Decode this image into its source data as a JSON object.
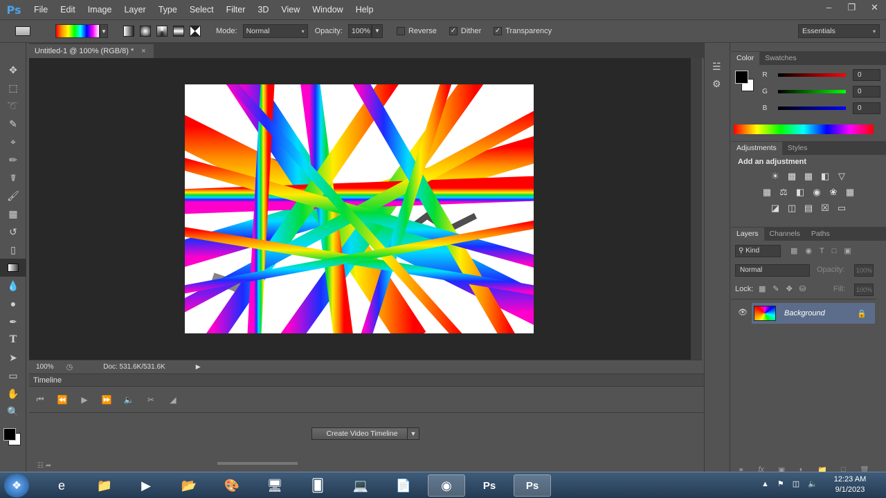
{
  "app": {
    "logo": "Ps"
  },
  "menu": [
    "File",
    "Edit",
    "Image",
    "Layer",
    "Type",
    "Select",
    "Filter",
    "3D",
    "View",
    "Window",
    "Help"
  ],
  "window_controls": [
    "minimize-icon",
    "restore-icon",
    "close-icon"
  ],
  "options": {
    "mode_label": "Mode:",
    "mode_value": "Normal",
    "opacity_label": "Opacity:",
    "opacity_value": "100%",
    "reverse_label": "Reverse",
    "dither_label": "Dither",
    "transparency_label": "Transparency",
    "reverse_checked": false,
    "dither_checked": true,
    "transparency_checked": true,
    "workspace": "Essentials"
  },
  "document": {
    "tab_title": "Untitled-1 @ 100% (RGB/8) *",
    "zoom": "100%",
    "doc_size": "Doc: 531.6K/531.6K"
  },
  "timeline": {
    "title": "Timeline",
    "create_button": "Create Video Timeline"
  },
  "color_panel": {
    "tabs": [
      "Color",
      "Swatches"
    ],
    "r_label": "R",
    "g_label": "G",
    "b_label": "B",
    "r_value": "0",
    "g_value": "0",
    "b_value": "0"
  },
  "adjustments_panel": {
    "tabs": [
      "Adjustments",
      "Styles"
    ],
    "heading": "Add an adjustment"
  },
  "layers_panel": {
    "tabs": [
      "Layers",
      "Channels",
      "Paths"
    ],
    "filter_kind": "Kind",
    "blend_mode": "Normal",
    "opacity_label": "Opacity:",
    "opacity_value": "100%",
    "lock_label": "Lock:",
    "fill_label": "Fill:",
    "fill_value": "100%",
    "layers": [
      {
        "name": "Background",
        "visible": true,
        "locked": true
      }
    ]
  },
  "taskbar": {
    "time": "12:23 AM",
    "date": "9/1/2023"
  },
  "colors": {
    "ui_bg": "#535353",
    "canvas_bg": "#282828",
    "accent": "#4ca1e8",
    "layer_selected": "#5b6d8a"
  }
}
